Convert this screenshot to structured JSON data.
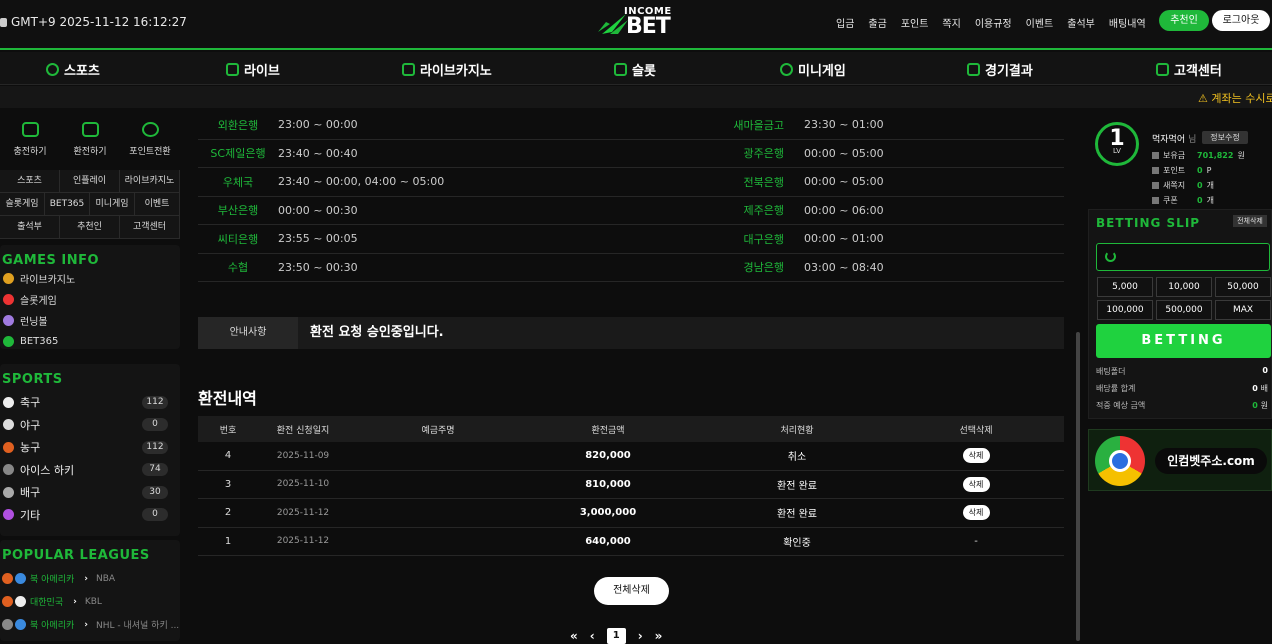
{
  "header": {
    "clock": "GMT+9 2025-11-12 16:12:27",
    "logo_top": "INCOME",
    "logo_bottom": "BET",
    "top_links": [
      "입금",
      "출금",
      "포인트",
      "쪽지",
      "이용규정",
      "이벤트",
      "출석부",
      "배팅내역"
    ],
    "recommend": "추천인",
    "logout": "로그아웃"
  },
  "mainnav": [
    "스포츠",
    "라이브",
    "라이브카지노",
    "슬롯",
    "미니게임",
    "경기결과",
    "고객센터"
  ],
  "ticker": "⚠ 계좌는 수시로",
  "quick": [
    "충전하기",
    "환전하기",
    "포인트전환"
  ],
  "grid_menu": [
    [
      "스포츠",
      "인플레이",
      "라이브카지노"
    ],
    [
      "슬롯게임",
      "BET365",
      "미니게임",
      "이벤트"
    ],
    [
      "출석부",
      "추천인",
      "고객센터"
    ]
  ],
  "games_info": {
    "title": "GAMES INFO",
    "items": [
      "라이브카지노",
      "슬롯게임",
      "런닝볼",
      "BET365"
    ]
  },
  "sports": {
    "title": "SPORTS",
    "items": [
      {
        "name": "축구",
        "count": "112"
      },
      {
        "name": "야구",
        "count": "0"
      },
      {
        "name": "농구",
        "count": "112"
      },
      {
        "name": "아이스 하키",
        "count": "74"
      },
      {
        "name": "배구",
        "count": "30"
      },
      {
        "name": "기타",
        "count": "0"
      }
    ]
  },
  "leagues": {
    "title": "POPULAR LEAGUES",
    "items": [
      {
        "country": "북 아메리카",
        "league": "NBA"
      },
      {
        "country": "대한민국",
        "league": "KBL"
      },
      {
        "country": "북 아메리카",
        "league": "NHL - 내셔널 하키 ..."
      }
    ]
  },
  "bank_schedule": [
    {
      "bank1": "외환은행",
      "time1": "23:00 ~ 00:00",
      "bank2": "새마을금고",
      "time2": "23:30 ~ 01:00"
    },
    {
      "bank1": "SC제일은행",
      "time1": "23:40 ~ 00:40",
      "bank2": "광주은행",
      "time2": "00:00 ~ 05:00"
    },
    {
      "bank1": "우체국",
      "time1": "23:40 ~ 00:00, 04:00 ~ 05:00",
      "bank2": "전북은행",
      "time2": "00:00 ~ 05:00"
    },
    {
      "bank1": "부산은행",
      "time1": "00:00 ~ 00:30",
      "bank2": "제주은행",
      "time2": "00:00 ~ 06:00"
    },
    {
      "bank1": "씨티은행",
      "time1": "23:55 ~ 00:05",
      "bank2": "대구은행",
      "time2": "00:00 ~ 01:00"
    },
    {
      "bank1": "수협",
      "time1": "23:50 ~ 00:30",
      "bank2": "경남은행",
      "time2": "03:00 ~ 08:40"
    }
  ],
  "notice": {
    "label": "안내사항",
    "message": "환전 요청 승인중입니다."
  },
  "history": {
    "title": "환전내역",
    "headers": [
      "번호",
      "환전 신청일지",
      "예금주명",
      "환전금액",
      "처리현황",
      "선택삭제"
    ],
    "rows": [
      {
        "no": "4",
        "date": "2025-11-09",
        "holder": "",
        "amount": "820,000",
        "status": "취소",
        "action": "삭제"
      },
      {
        "no": "3",
        "date": "2025-11-10",
        "holder": "",
        "amount": "810,000",
        "status": "환전 완료",
        "action": "삭제"
      },
      {
        "no": "2",
        "date": "2025-11-12",
        "holder": "",
        "amount": "3,000,000",
        "status": "환전 완료",
        "action": "삭제"
      },
      {
        "no": "1",
        "date": "2025-11-12",
        "holder": "",
        "amount": "640,000",
        "status": "확인중",
        "action": "-"
      }
    ],
    "delete_all": "전체삭제",
    "pager": {
      "first": "«",
      "prev": "‹",
      "current": "1",
      "next": "›",
      "last": "»"
    }
  },
  "user": {
    "level": "1",
    "level_label": "LV",
    "name": "먹자먹어",
    "name_suffix": "님",
    "edit": "정보수정",
    "balance_label": "보유금",
    "balance": "701,822",
    "balance_unit": "원",
    "point_label": "포인트",
    "point": "0",
    "point_unit": "P",
    "msg_label": "새쪽지",
    "msg": "0",
    "msg_unit": "개",
    "coupon_label": "쿠폰",
    "coupon": "0",
    "coupon_unit": "개"
  },
  "slip": {
    "title": "BETTING SLIP",
    "tag": "전체삭제",
    "amounts": [
      "5,000",
      "10,000",
      "50,000",
      "100,000",
      "500,000",
      "MAX"
    ],
    "bet_button": "BETTING",
    "stats": [
      {
        "label": "배팅폴더",
        "value": "0",
        "unit": ""
      },
      {
        "label": "배당률 합계",
        "value": "0",
        "unit": "배"
      },
      {
        "label": "적중 예상 금액",
        "value": "0",
        "unit": "원"
      }
    ]
  },
  "banner": {
    "text": "인컴벳주소.com"
  },
  "colors": {
    "accent": "#1fb83a",
    "background": "#0d0d0d"
  }
}
